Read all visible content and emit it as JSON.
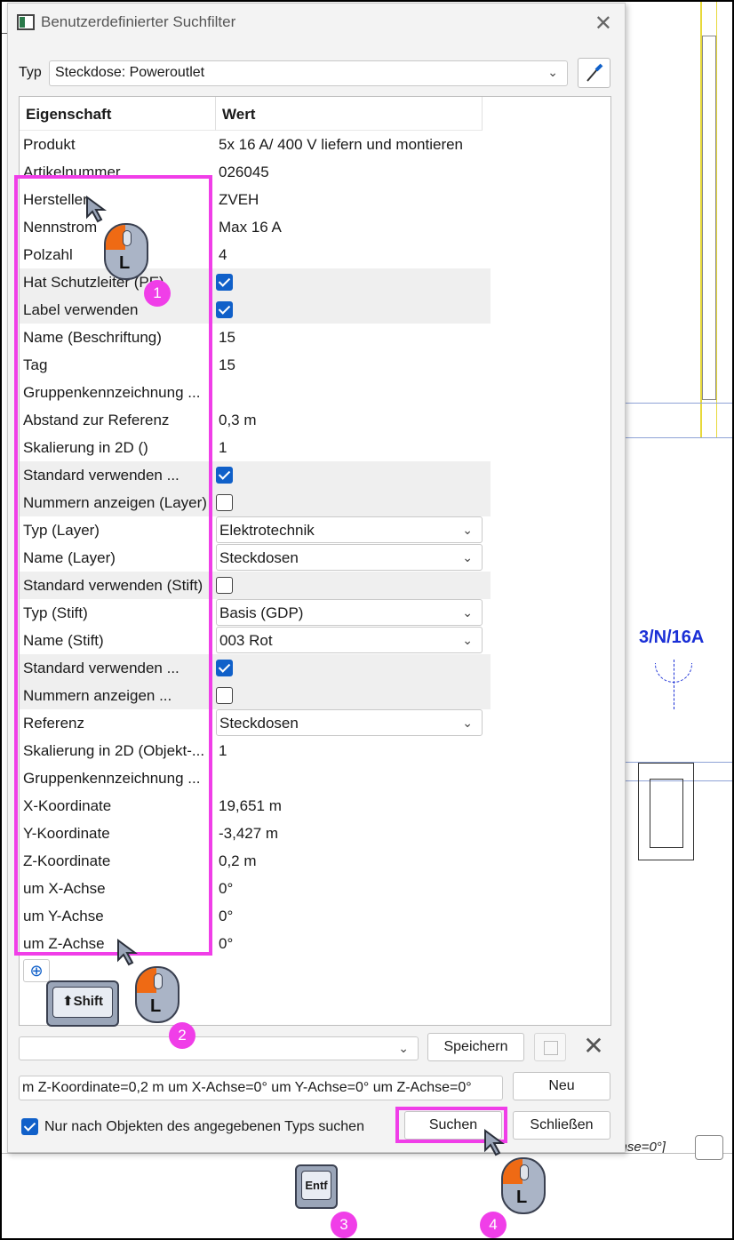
{
  "dialog": {
    "title": "Benutzerdefinierter Suchfilter",
    "close_glyph": "✕",
    "typ_label": "Typ",
    "typ_value": "Steckdose: Poweroutlet"
  },
  "table": {
    "header_property": "Eigenschaft",
    "header_value": "Wert",
    "rows": [
      {
        "p": "Produkt",
        "v": "5x 16 A/ 400 V liefern und montieren"
      },
      {
        "p": "Artikelnummer",
        "v": "026045"
      },
      {
        "p": "Hersteller",
        "v": "ZVEH"
      },
      {
        "p": "Nennstrom",
        "v": "Max 16 A"
      },
      {
        "p": "Polzahl",
        "v": "4"
      },
      {
        "p": "Hat Schutzleiter (PE)",
        "v": ""
      },
      {
        "p": "Label verwenden",
        "v": ""
      },
      {
        "p": "Name (Beschriftung)",
        "v": "15"
      },
      {
        "p": "Tag",
        "v": "15"
      },
      {
        "p": "Gruppenkennzeichnung ...",
        "v": ""
      },
      {
        "p": "Abstand zur Referenz",
        "v": "0,3 m"
      },
      {
        "p": "Skalierung in 2D ()",
        "v": "1"
      },
      {
        "p": "Standard verwenden ...",
        "v": ""
      },
      {
        "p": "Nummern anzeigen (Layer)",
        "v": ""
      },
      {
        "p": "Typ (Layer)",
        "v": "Elektrotechnik"
      },
      {
        "p": "Name (Layer)",
        "v": "Steckdosen"
      },
      {
        "p": "Standard verwenden (Stift)",
        "v": ""
      },
      {
        "p": "Typ (Stift)",
        "v": "Basis (GDP)"
      },
      {
        "p": "Name (Stift)",
        "v": "003  Rot"
      },
      {
        "p": "Standard verwenden ...",
        "v": ""
      },
      {
        "p": "Nummern anzeigen ...",
        "v": ""
      },
      {
        "p": "Referenz",
        "v": "Steckdosen"
      },
      {
        "p": "Skalierung in 2D (Objekt-...",
        "v": "1"
      },
      {
        "p": "Gruppenkennzeichnung ...",
        "v": ""
      },
      {
        "p": "X-Koordinate",
        "v": "19,651 m"
      },
      {
        "p": "Y-Koordinate",
        "v": "-3,427 m"
      },
      {
        "p": "Z-Koordinate",
        "v": "0,2 m"
      },
      {
        "p": "um X-Achse",
        "v": "0°"
      },
      {
        "p": "um Y-Achse",
        "v": "0°"
      },
      {
        "p": "um Z-Achse",
        "v": "0°"
      }
    ],
    "checkboxes": {
      "5": true,
      "6": true,
      "12": true,
      "13": false,
      "16": false,
      "19": true,
      "20": false
    },
    "dropdowns": [
      14,
      15,
      17,
      18,
      21
    ],
    "add_glyph": "⊕"
  },
  "controls": {
    "save_label": "Speichern",
    "new_label": "Neu",
    "search_label": "Suchen",
    "close_label": "Schließen",
    "query_text": "m  Z-Koordinate=0,2 m  um X-Achse=0°  um Y-Achse=0°  um Z-Achse=0°",
    "only_type_label": "Nur nach Objekten des angegebenen Typs suchen",
    "delete_glyph": "✕"
  },
  "background": {
    "cad_label": "3/N/16A",
    "cad_text": "chse=0°]"
  },
  "annotations": {
    "badges": [
      "1",
      "2",
      "3",
      "4"
    ],
    "keys": {
      "shift": "Shift",
      "entf": "Entf"
    },
    "mouse_button": "L",
    "highlight_color": "#f03ee8"
  },
  "colors": {
    "accent": "#1060c9",
    "highlight": "#f03ee8",
    "mouse_left": "#ef6a14",
    "cad_blue": "#1a2fd6"
  }
}
